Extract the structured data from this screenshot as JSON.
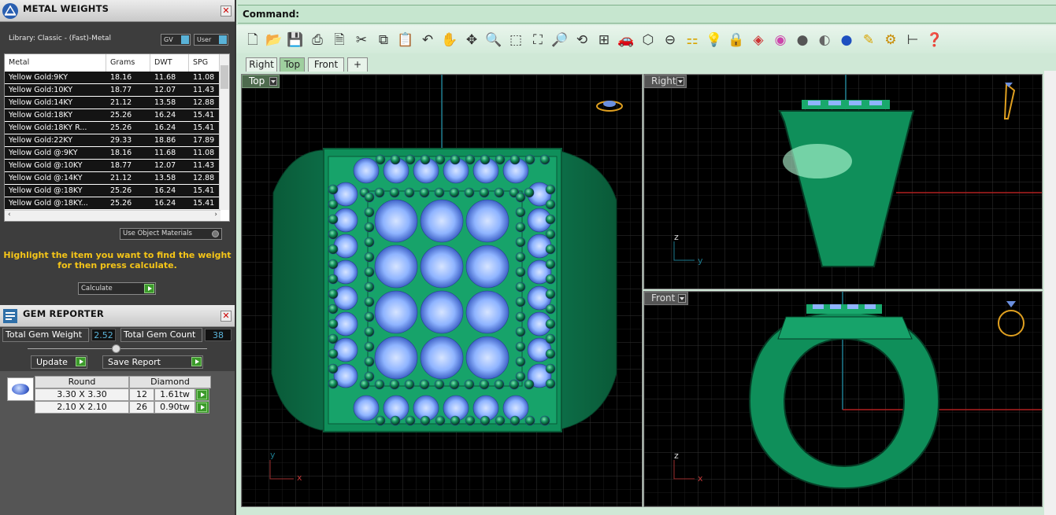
{
  "metal_weights": {
    "title": "METAL WEIGHTS",
    "library": "Library: Classic - (Fast)-Metal",
    "chip_gv": "GV",
    "chip_user": "User",
    "columns": [
      "Metal",
      "Grams",
      "DWT",
      "SPG"
    ],
    "rows": [
      [
        "Yellow Gold:9KY",
        "18.16",
        "11.68",
        "11.08"
      ],
      [
        "Yellow Gold:10KY",
        "18.77",
        "12.07",
        "11.43"
      ],
      [
        "Yellow Gold:14KY",
        "21.12",
        "13.58",
        "12.88"
      ],
      [
        "Yellow Gold:18KY",
        "25.26",
        "16.24",
        "15.41"
      ],
      [
        "Yellow Gold:18KY R...",
        "25.26",
        "16.24",
        "15.41"
      ],
      [
        "Yellow Gold:22KY",
        "29.33",
        "18.86",
        "17.89"
      ],
      [
        "Yellow Gold @:9KY",
        "18.16",
        "11.68",
        "11.08"
      ],
      [
        "Yellow Gold @:10KY",
        "18.77",
        "12.07",
        "11.43"
      ],
      [
        "Yellow Gold @:14KY",
        "21.12",
        "13.58",
        "12.88"
      ],
      [
        "Yellow Gold @:18KY",
        "25.26",
        "16.24",
        "15.41"
      ],
      [
        "Yellow Gold @:18KY...",
        "25.26",
        "16.24",
        "15.41"
      ]
    ],
    "use_object_materials": "Use Object Materials",
    "hint": "Highlight the item you want to find the weight for then press calculate.",
    "calculate": "Calculate"
  },
  "gem_reporter": {
    "title": "GEM REPORTER",
    "total_weight_label": "Total Gem Weight",
    "total_weight": "2.52",
    "total_count_label": "Total Gem Count",
    "total_count": "38",
    "update": "Update",
    "save_report": "Save Report",
    "header_shape": "Round",
    "header_type": "Diamond",
    "gems": [
      {
        "size": "3.30 X 3.30",
        "count": "12",
        "tw": "1.61tw"
      },
      {
        "size": "2.10 X 2.10",
        "count": "26",
        "tw": "0.90tw"
      }
    ]
  },
  "command": {
    "label": "Command:"
  },
  "tabs": [
    "Right",
    "Top",
    "Front",
    "+"
  ],
  "viewports": {
    "top": "Top",
    "right": "Right",
    "front": "Front"
  },
  "axes": {
    "x": "x",
    "y": "y",
    "z": "z"
  },
  "colors": {
    "ring_green": "#0f8f5a",
    "gem_blue": "#8fb4ff",
    "grid": "#3a3a3a",
    "panel": "#3d3d3d"
  }
}
